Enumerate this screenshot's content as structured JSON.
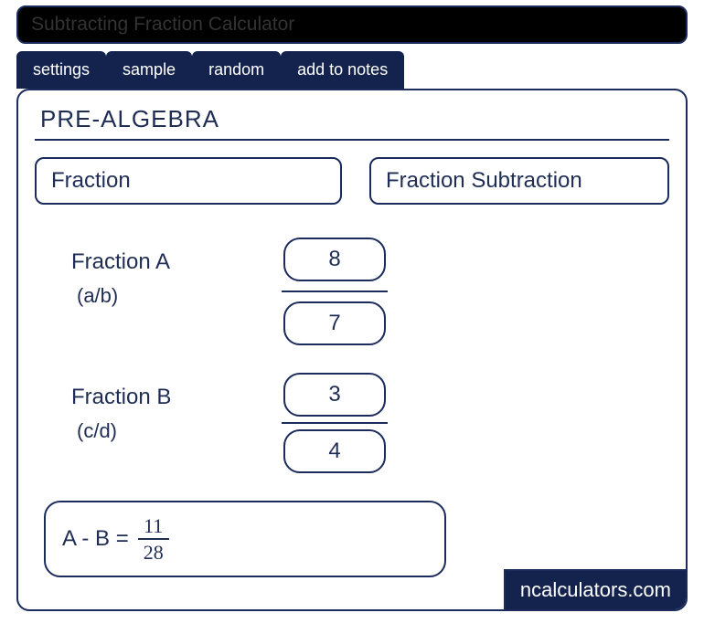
{
  "title": "Subtracting Fraction Calculator",
  "tabs": [
    {
      "label": "settings"
    },
    {
      "label": "sample"
    },
    {
      "label": "random"
    },
    {
      "label": "add to notes"
    }
  ],
  "section_title": "PRE-ALGEBRA",
  "pill_left": "Fraction",
  "pill_right": "Fraction Subtraction",
  "fractionA": {
    "label": "Fraction A",
    "sublabel": "(a/b)",
    "numerator": "8",
    "denominator": "7"
  },
  "fractionB": {
    "label": "Fraction B",
    "sublabel": "(c/d)",
    "numerator": "3",
    "denominator": "4"
  },
  "result": {
    "label": "A - B  =",
    "numerator": "11",
    "denominator": "28"
  },
  "brand": "ncalculators.com"
}
